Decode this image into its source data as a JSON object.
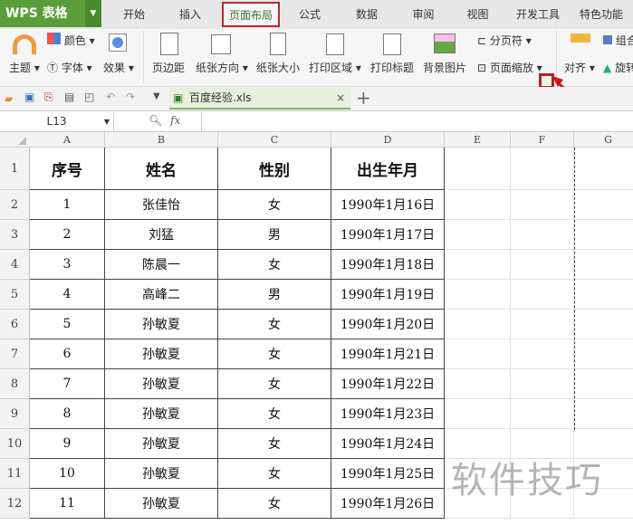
{
  "app": {
    "logo": "WPS 表格"
  },
  "tabs": [
    {
      "label": "开始"
    },
    {
      "label": "插入"
    },
    {
      "label": "页面布局",
      "active": true
    },
    {
      "label": "公式"
    },
    {
      "label": "数据"
    },
    {
      "label": "审阅"
    },
    {
      "label": "视图"
    },
    {
      "label": "开发工具"
    },
    {
      "label": "特色功能"
    }
  ],
  "ribbon": {
    "theme": "主题",
    "color": "颜色",
    "font": "字体",
    "effect": "效果",
    "margin": "页边距",
    "orientation": "纸张方向",
    "size": "纸张大小",
    "print_area": "打印区域",
    "print_title": "打印标题",
    "background": "背景图片",
    "page_break": "分页符",
    "page_scale": "页面缩放",
    "align": "对齐",
    "group": "组合",
    "rotate": "旋转"
  },
  "document_tab": {
    "name": "百度经验.xls"
  },
  "formula_bar": {
    "cell_ref": "L13",
    "fx": "fx",
    "value": ""
  },
  "columns": [
    "A",
    "B",
    "C",
    "D",
    "E",
    "F",
    "G"
  ],
  "table": {
    "headers": [
      "序号",
      "姓名",
      "性别",
      "出生年月"
    ],
    "rows": [
      [
        "1",
        "张佳怡",
        "女",
        "1990年1月16日"
      ],
      [
        "2",
        "刘猛",
        "男",
        "1990年1月17日"
      ],
      [
        "3",
        "陈晨一",
        "女",
        "1990年1月18日"
      ],
      [
        "4",
        "高峰二",
        "男",
        "1990年1月19日"
      ],
      [
        "5",
        "孙敏夏",
        "女",
        "1990年1月20日"
      ],
      [
        "6",
        "孙敏夏",
        "女",
        "1990年1月21日"
      ],
      [
        "7",
        "孙敏夏",
        "女",
        "1990年1月22日"
      ],
      [
        "8",
        "孙敏夏",
        "女",
        "1990年1月23日"
      ],
      [
        "9",
        "孙敏夏",
        "女",
        "1990年1月24日"
      ],
      [
        "10",
        "孙敏夏",
        "女",
        "1990年1月25日"
      ],
      [
        "11",
        "孙敏夏",
        "女",
        "1990年1月26日"
      ]
    ]
  },
  "row_numbers": [
    "1",
    "2",
    "3",
    "4",
    "5",
    "6",
    "7",
    "8",
    "9",
    "10",
    "11",
    "12"
  ],
  "watermark": "软件技巧",
  "colors": {
    "accent": "#5a9e3a",
    "highlight": "#c0262c"
  }
}
